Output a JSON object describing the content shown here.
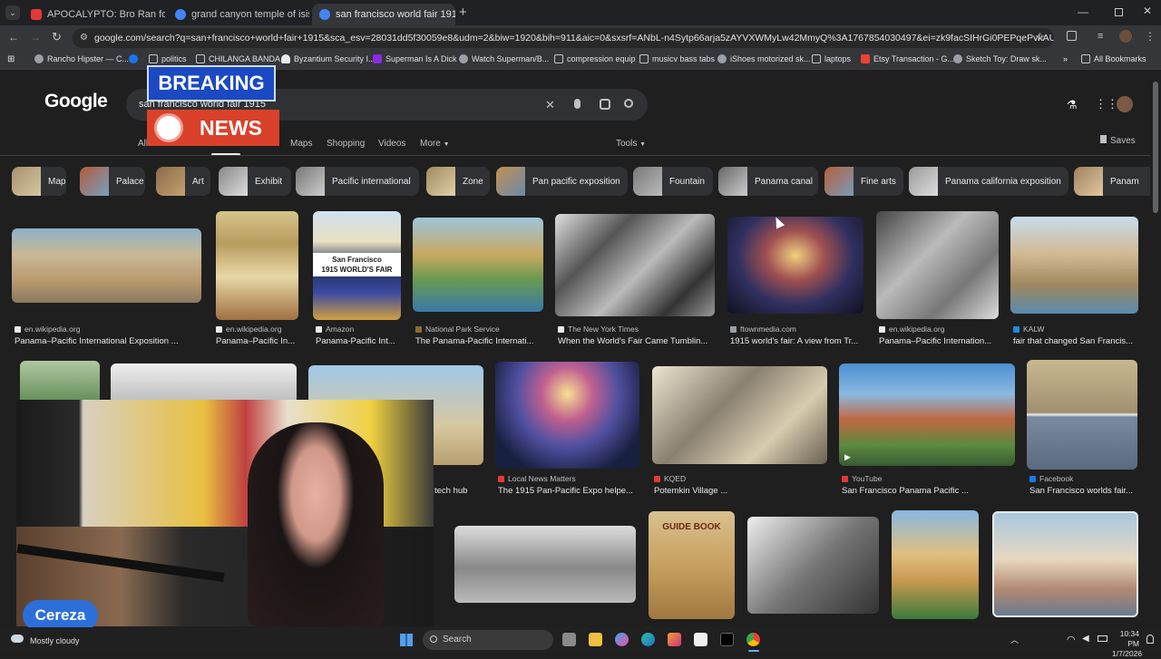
{
  "browser": {
    "tabs": [
      {
        "title": "APOCALYPTO: Bro Ran for His L",
        "favicon_color": "#e53935"
      },
      {
        "title": "grand canyon temple of isis - G",
        "favicon_color": "#4285f4"
      },
      {
        "title": "san francisco world fair 1915 - G",
        "favicon_color": "#4285f4"
      }
    ],
    "new_tab": "+",
    "url": "google.com/search?q=san+francisco+world+fair+1915&sca_esv=28031dd5f30059e8&udm=2&biw=1920&bih=911&aic=0&sxsrf=ANbL-n4Sytp66arja5zAYVXWMyLw42MmyQ%3A1767854030497&ei=zk9facSIHrGi0PEPqePvkAU&oq=san+francisco...",
    "bookmarks": [
      {
        "label": "Rancho Hipster — C..."
      },
      {
        "label": ""
      },
      {
        "label": "politics"
      },
      {
        "label": "CHILANGA BANDA"
      },
      {
        "label": "Byzantium Security I..."
      },
      {
        "label": "Superman Is A Dick"
      },
      {
        "label": "Watch Superman/B..."
      },
      {
        "label": "compression equip"
      },
      {
        "label": "musicv bass tabs"
      },
      {
        "label": "iShoes motorized sk..."
      },
      {
        "label": "laptops"
      },
      {
        "label": "Etsy Transaction - G..."
      },
      {
        "label": "Sketch Toy: Draw sk..."
      }
    ],
    "all_bookmarks": "All Bookmarks",
    "more_bookmarks": "»"
  },
  "google": {
    "logo": "Google",
    "query": "san francisco world fair 1915",
    "nav_tabs": [
      "All",
      "Maps",
      "Shopping",
      "Videos",
      "More",
      "Tools"
    ],
    "saves": "Saves",
    "chips": [
      "Map",
      "Palace",
      "Art",
      "Exhibit",
      "Pacific international",
      "Zone",
      "Pan pacific exposition",
      "Fountain",
      "Panama canal",
      "Fine arts",
      "Panama california exposition",
      "Panam"
    ],
    "row1": [
      {
        "source": "en.wikipedia.org",
        "title": "Panama–Pacific International Exposition ...",
        "src_color": "#8ab4f8"
      },
      {
        "source": "en.wikipedia.org",
        "title": "Panama–Pacific In...",
        "src_color": "#8ab4f8"
      },
      {
        "source": "Amazon",
        "title": "Panama-Pacific Int...",
        "src_color": "#f4b400"
      },
      {
        "source": "National Park Service",
        "title": "The Panama-Pacific Internati...",
        "src_color": "#6b8e23"
      },
      {
        "source": "The New York Times",
        "title": "When the World's Fair Came Tumblin...",
        "src_color": "#ffffff"
      },
      {
        "source": "ftownmedia.com",
        "title": "1915 world's fair: A view from Tr...",
        "src_color": "#9aa0a6"
      },
      {
        "source": "en.wikipedia.org",
        "title": "Panama–Pacific Internation...",
        "src_color": "#8ab4f8"
      },
      {
        "source": "KALW",
        "title": "fair that changed San Francis...",
        "src_color": "#1e88e5"
      }
    ],
    "row2": [
      {
        "source": "",
        "title": "tech hub",
        "src_color": "#9aa0a6"
      },
      {
        "source": "Local News Matters",
        "title": "The 1915 Pan-Pacific Expo helpe...",
        "src_color": "#e53935"
      },
      {
        "source": "KQED",
        "title": "Potemkin Village ...",
        "src_color": "#e53935"
      },
      {
        "source": "YouTube",
        "title": "San Francisco Panama Pacific ...",
        "src_color": "#e53935"
      },
      {
        "source": "Facebook",
        "title": "San Francisco worlds fair...",
        "src_color": "#1877f2"
      }
    ],
    "image3_text": "1915 WORLD'S FAIR",
    "image3_sub": "San Francisco",
    "image_guidebook": "GUIDE BOOK"
  },
  "overlay": {
    "breaking": "BREAKING",
    "news": "NEWS",
    "streamer": "Cereza"
  },
  "taskbar": {
    "weather": "Mostly cloudy",
    "search": "Search",
    "time": "10:34 PM",
    "date": "1/7/2026"
  }
}
